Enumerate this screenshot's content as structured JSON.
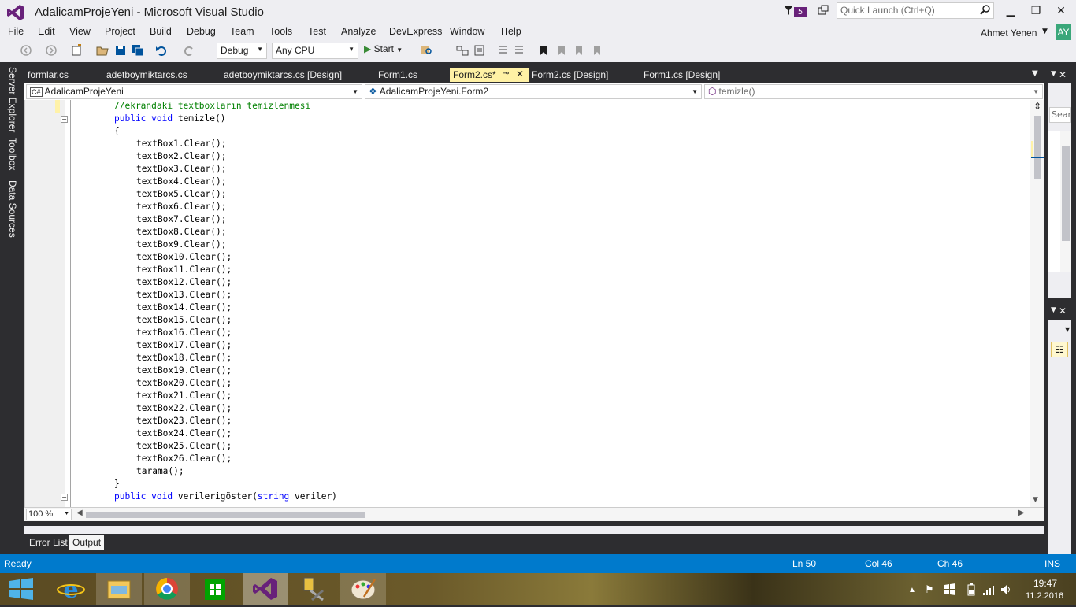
{
  "window": {
    "title": "AdalicamProjeYeni - Microsoft Visual Studio",
    "notification_count": "5",
    "quick_launch_placeholder": "Quick Launch (Ctrl+Q)",
    "minimize": "▁",
    "restore": "❐",
    "close": "✕"
  },
  "menu": [
    "File",
    "Edit",
    "View",
    "Project",
    "Build",
    "Debug",
    "Team",
    "Tools",
    "Test",
    "Analyze",
    "DevExpress",
    "Window",
    "Help"
  ],
  "user": {
    "name": "Ahmet Yenen",
    "initials": "AY"
  },
  "toolbar": {
    "config": "Debug",
    "platform": "Any CPU",
    "start_label": "Start"
  },
  "left_tabs": [
    "Server Explorer",
    "Toolbox",
    "Data Sources"
  ],
  "doc_tabs": [
    {
      "label": "formlar.cs"
    },
    {
      "label": "adetboymiktarcs.cs"
    },
    {
      "label": "adetboymiktarcs.cs [Design]"
    },
    {
      "label": "Form1.cs"
    },
    {
      "label": "Form2.cs*",
      "active": true
    },
    {
      "label": "Form2.cs [Design]"
    },
    {
      "label": "Form1.cs [Design]"
    }
  ],
  "nav": {
    "project": "AdalicamProjeYeni",
    "class": "AdalicamProjeYeni.Form2",
    "member": "temizle()"
  },
  "code": {
    "comment": "//ekrandaki textboxların temizlenmesi",
    "method_decl_kw": "public void",
    "method_decl_name": " temizle()",
    "open_brace": "{",
    "lines": [
      "textBox1.Clear();",
      "textBox2.Clear();",
      "textBox3.Clear();",
      "textBox4.Clear();",
      "textBox5.Clear();",
      "textBox6.Clear();",
      "textBox7.Clear();",
      "textBox8.Clear();",
      "textBox9.Clear();",
      "textBox10.Clear();",
      "textBox11.Clear();",
      "textBox12.Clear();",
      "textBox13.Clear();",
      "textBox14.Clear();",
      "textBox15.Clear();",
      "textBox16.Clear();",
      "textBox17.Clear();",
      "textBox18.Clear();",
      "textBox19.Clear();",
      "textBox20.Clear();",
      "textBox21.Clear();",
      "textBox22.Clear();",
      "textBox23.Clear();",
      "textBox24.Clear();",
      "textBox25.Clear();",
      "textBox26.Clear();",
      "tarama();"
    ],
    "close_brace": "}",
    "next_decl_kw": "public void",
    "next_decl_name": " verilerigöster(",
    "next_decl_param_kw": "string",
    "next_decl_param": " veriler)"
  },
  "editor": {
    "zoom": "100 %"
  },
  "right_panel": {
    "search_placeholder": "Sear"
  },
  "bottom_tabs": [
    "Error List",
    "Output"
  ],
  "status": {
    "ready": "Ready",
    "line": "Ln 50",
    "col": "Col 46",
    "ch": "Ch 46",
    "mode": "INS"
  },
  "taskbar": {
    "time": "19:47",
    "date": "11.2.2016"
  },
  "colors": {
    "accent": "#007acc",
    "vs_purple": "#68217a",
    "active_tab": "#fff1a5",
    "keyword": "#0000ff",
    "comment": "#008000"
  }
}
